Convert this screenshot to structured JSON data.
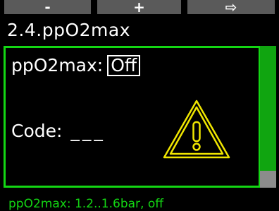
{
  "softkeys": {
    "minus": "-",
    "plus": "+",
    "next": "⇨"
  },
  "title": "2.4.ppO2max",
  "setting": {
    "label": "ppO2max:",
    "value": "Off"
  },
  "code": {
    "label": "Code:",
    "placeholder": "___"
  },
  "warning_icon": "warning-triangle-icon",
  "scrollbar": {
    "position": "bottom"
  },
  "footer_hint": "ppO2max: 1.2..1.6bar, off",
  "colors": {
    "accent_green": "#13d613",
    "warning_yellow": "#f0e600",
    "softkey_gray": "#5a5a5a",
    "background": "#000000"
  }
}
